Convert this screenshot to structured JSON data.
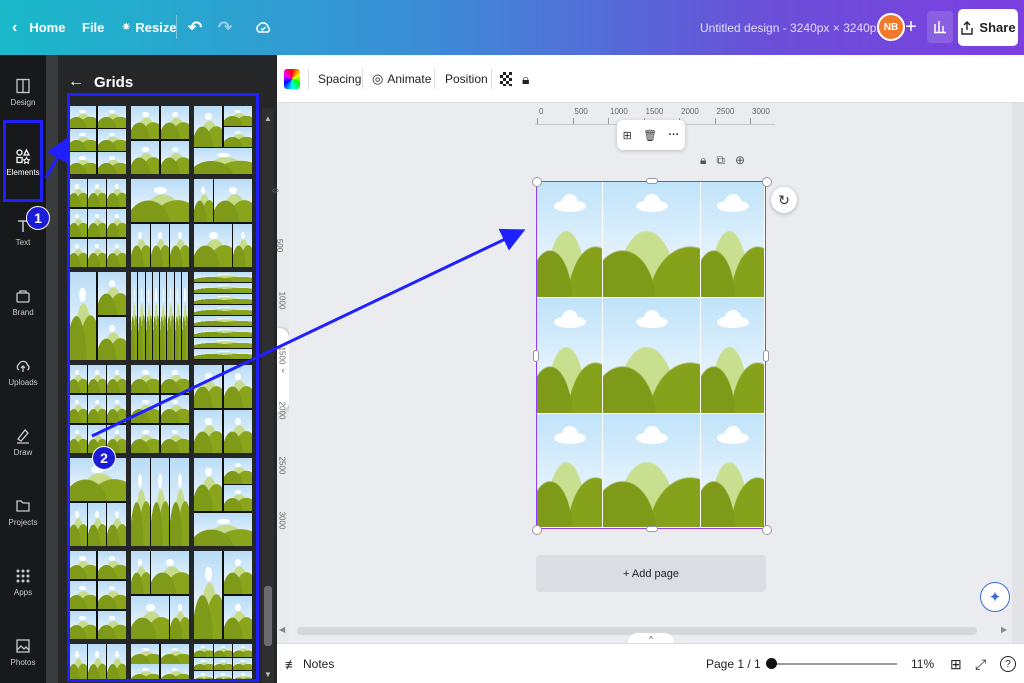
{
  "topbar": {
    "home_label": "Home",
    "file_label": "File",
    "resize_label": "Resize",
    "doc_title": "Untitled design - 3240px × 3240px",
    "avatar_initials": "NB",
    "share_label": "Share"
  },
  "rail": {
    "items": [
      {
        "label": "Design",
        "icon": "design-icon"
      },
      {
        "label": "Elements",
        "icon": "elements-icon"
      },
      {
        "label": "Text",
        "icon": "text-icon"
      },
      {
        "label": "Brand",
        "icon": "brand-icon"
      },
      {
        "label": "Uploads",
        "icon": "uploads-icon"
      },
      {
        "label": "Draw",
        "icon": "draw-icon"
      },
      {
        "label": "Projects",
        "icon": "projects-icon"
      },
      {
        "label": "Apps",
        "icon": "apps-icon"
      },
      {
        "label": "Photos",
        "icon": "photos-icon"
      }
    ]
  },
  "panel": {
    "title": "Grids"
  },
  "toolbar": {
    "spacing_label": "Spacing",
    "animate_label": "Animate",
    "position_label": "Position"
  },
  "ruler": {
    "top_ticks": [
      "0",
      "500",
      "1000",
      "1500",
      "2000",
      "2500",
      "3000"
    ],
    "left_ticks": [
      "0",
      "500",
      "1000",
      "1500",
      "2000",
      "2500",
      "3000"
    ]
  },
  "canvas": {
    "add_page_label": "+ Add page"
  },
  "bottombar": {
    "notes_label": "Notes",
    "page_indicator": "Page 1 / 1",
    "zoom_value": "11%"
  },
  "annotations": {
    "step1": "1",
    "step2": "2",
    "color": "#1f1fff"
  },
  "colors": {
    "accent": "#8b3dff",
    "topbar_start": "#1ab9c9",
    "topbar_end": "#7c3fe0"
  }
}
